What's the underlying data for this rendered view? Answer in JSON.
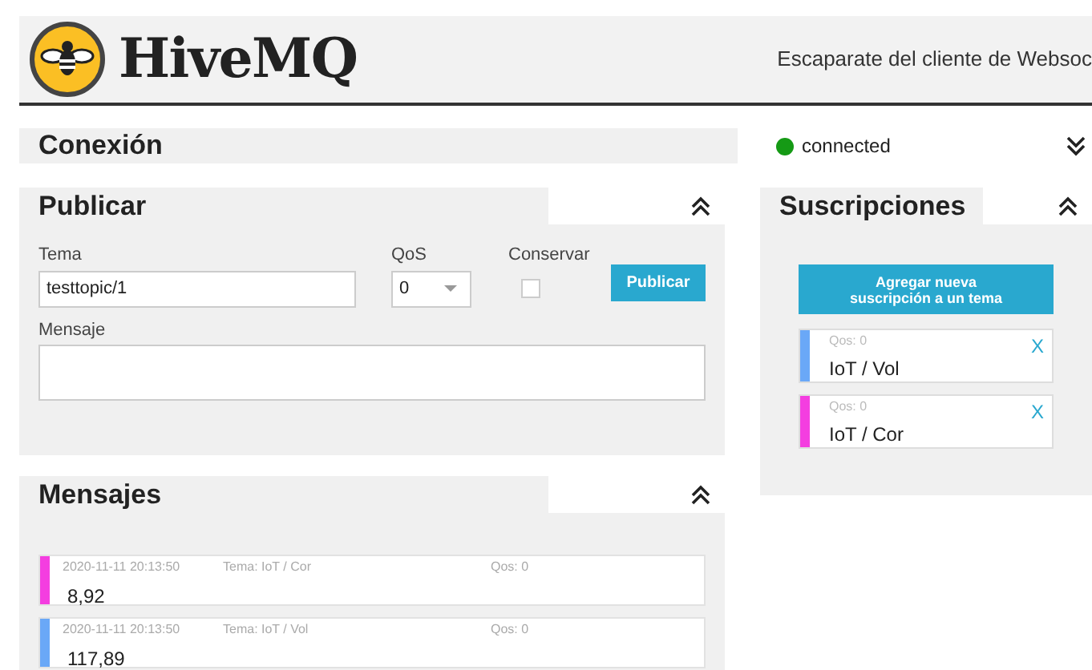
{
  "header": {
    "logo_text": "HiveMQ",
    "subtitle": "Escaparate del cliente de Websoc"
  },
  "connection": {
    "title": "Conexión",
    "status": "connected",
    "connected": true
  },
  "publish": {
    "title": "Publicar",
    "topic_label": "Tema",
    "topic": "testtopic/1",
    "qos_label": "QoS",
    "qos": "0",
    "retain_label": "Conservar",
    "retain": false,
    "button": "Publicar",
    "message_label": "Mensaje"
  },
  "subscriptions": {
    "title": "Suscripciones",
    "add_button": "Agregar nueva suscripción a un tema",
    "items": [
      {
        "qos": "Qos: 0",
        "topic": "IoT / Vol",
        "color": "#6aa8f7",
        "remove": "X"
      },
      {
        "qos": "Qos: 0",
        "topic": "IoT / Cor",
        "color": "#f43ee0",
        "remove": "X"
      }
    ]
  },
  "messages": {
    "title": "Mensajes",
    "items": [
      {
        "time": "2020-11-11 20:13:50",
        "topic": "Tema: IoT / Cor",
        "qos": "Qos: 0",
        "payload": "8,92",
        "color": "#f43ee0"
      },
      {
        "time": "2020-11-11 20:13:50",
        "topic": "Tema: IoT / Vol",
        "qos": "Qos: 0",
        "payload": "117,89",
        "color": "#6aa8f7"
      }
    ]
  }
}
